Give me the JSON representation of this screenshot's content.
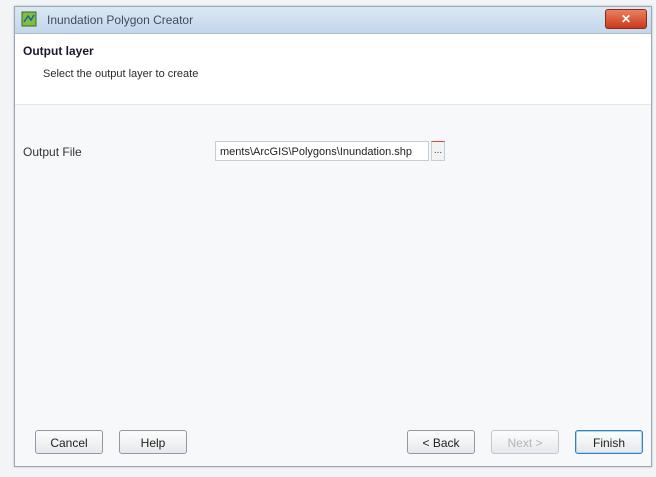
{
  "window": {
    "title": "Inundation Polygon Creator",
    "close_label": "✕"
  },
  "header": {
    "title": "Output layer",
    "subtitle": "Select the output layer to create"
  },
  "form": {
    "output_file_label": "Output File",
    "output_file_value": "ments\\ArcGIS\\Polygons\\Inundation.shp",
    "browse_label": "..."
  },
  "buttons": {
    "cancel": "Cancel",
    "help": "Help",
    "back": "< Back",
    "next": "Next >",
    "finish": "Finish"
  }
}
